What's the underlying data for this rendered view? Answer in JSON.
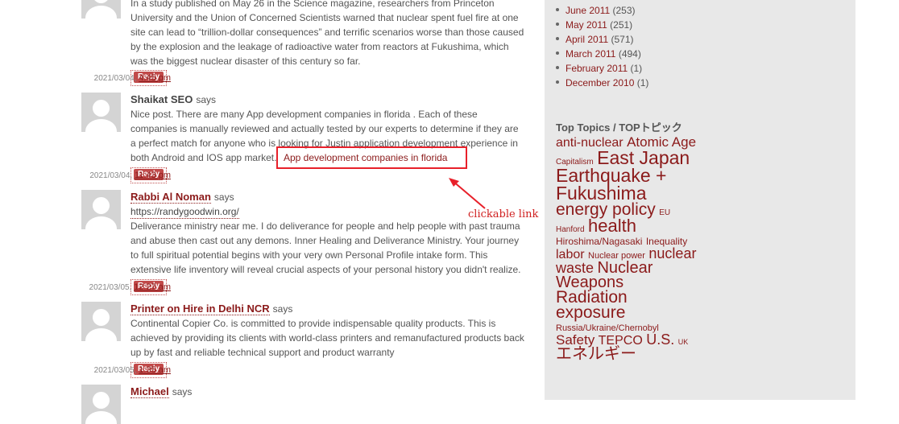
{
  "comments": [
    {
      "body_lines": [
        "In a study published on May 26 in the Science magazine, researchers from Princeton",
        "University and the Union of Concerned Scientists warned that nuclear spent fuel fire at one",
        "site can lead to “trillion-dollar consequences” and terrific scenarios worse than those caused",
        "by the explosion and the leakage of radioactive water from reactors at Fukushima, which",
        "was the biggest nuclear disaster of this century so far."
      ],
      "reply": "Reply",
      "date": "2021/03/04,",
      "time": "4:45 pm"
    },
    {
      "author": "Shaikat SEO",
      "says": "says",
      "body_lines": [
        "Nice post. There are many App development companies in florida . Each of these",
        "companies is manually reviewed and actually tested by our experts to determine if they are",
        "a perfect match for anyone who is looking for Justin application development experience in",
        "both Android and IOS app market."
      ],
      "link_text": "App development companies in florida",
      "reply": "Reply",
      "date": "2021/03/04,",
      "time": "11:43 pm"
    },
    {
      "author": "Rabbi Al Noman",
      "says": "says",
      "url": "https://randygoodwin.org/",
      "body_lines": [
        "Deliverance ministry near me. I do deliverance for people and help people with past trauma",
        "and abuse then cast out any demons. Inner Healing and Deliverance Ministry. Your journey",
        "to full spiritual potential begins with your very own Personal Profile intake form. This",
        "extensive life inventory will reveal crucial aspects of your personal history you didn't realize."
      ],
      "reply": "Reply",
      "date": "2021/03/05,",
      "time": "12:27 am"
    },
    {
      "author": "Printer on Hire in Delhi NCR",
      "says": "says",
      "body_lines": [
        "Continental Copier Co. is committed to provide indispensable quality products. This is",
        "achieved by providing its clients with world-class printers and remanufactured products back",
        "up by fast and reliable technical support and product warranty"
      ],
      "reply": "Reply",
      "date": "2021/03/05,",
      "time": "1:35 am"
    },
    {
      "author": "Michael",
      "says": "says"
    }
  ],
  "annotation": {
    "label": "clickable link",
    "color": "#e8202a"
  },
  "archives": [
    {
      "month": "June 2011",
      "count": "(253)"
    },
    {
      "month": "May 2011",
      "count": "(251)"
    },
    {
      "month": "April 2011",
      "count": "(571)"
    },
    {
      "month": "March 2011",
      "count": "(494)"
    },
    {
      "month": "February 2011",
      "count": "(1)"
    },
    {
      "month": "December 2010",
      "count": "(1)"
    }
  ],
  "topics": {
    "title": "Top Topics / TOPトピック",
    "tags": [
      {
        "label": "anti-nuclear",
        "size": 16
      },
      {
        "label": "Atomic Age",
        "size": 17
      },
      {
        "label": "Capitalism",
        "size": 10
      },
      {
        "label": "East Japan Earthquake + Fukushima",
        "size": 23
      },
      {
        "label": "energy policy",
        "size": 21
      },
      {
        "label": "EU",
        "size": 10
      },
      {
        "label": "Hanford",
        "size": 10
      },
      {
        "label": "health",
        "size": 22
      },
      {
        "label": "Hiroshima/Nagasaki",
        "size": 12
      },
      {
        "label": "Inequality",
        "size": 12
      },
      {
        "label": "labor",
        "size": 16
      },
      {
        "label": "Nuclear power",
        "size": 11
      },
      {
        "label": "nuclear waste",
        "size": 18
      },
      {
        "label": "Nuclear Weapons",
        "size": 20
      },
      {
        "label": "Radiation exposure",
        "size": 21
      },
      {
        "label": "Russia/Ukraine/Chernobyl",
        "size": 11
      },
      {
        "label": "Safety",
        "size": 17
      },
      {
        "label": "TEPCO",
        "size": 16
      },
      {
        "label": "U.S.",
        "size": 18
      },
      {
        "label": "UK",
        "size": 9
      },
      {
        "label": "エネルギー",
        "size": 20
      }
    ]
  },
  "colors": {
    "link": "#8b1a1a",
    "reply": "#c14a4a",
    "sidebar_bg": "#e8e8e8"
  }
}
